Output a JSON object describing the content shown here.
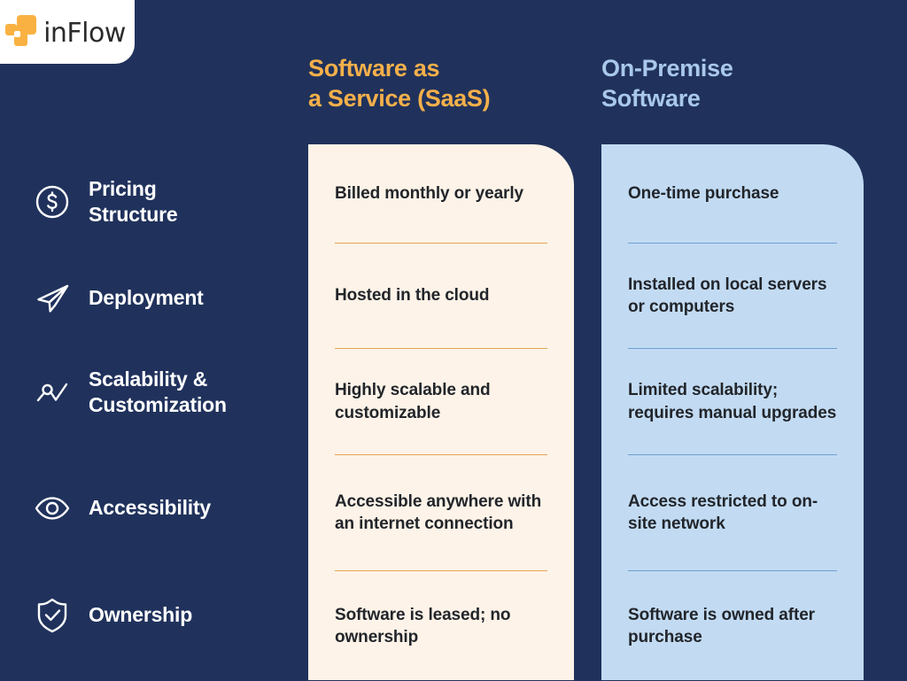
{
  "brand": {
    "logo_text": "inFlow",
    "logo_mark_name": "inflow-cube-logo",
    "logo_accent_color": "#f9b242"
  },
  "theme": {
    "background": "#20325c",
    "saas_accent": "#f5b04a",
    "saas_card_bg": "#fdf3e8",
    "saas_divider": "#e3a552",
    "onprem_accent": "#a9c8ea",
    "onprem_card_bg": "#c2dbf3",
    "onprem_divider": "#6f9fd0",
    "label_text": "#ffffff",
    "cell_text": "#22252a"
  },
  "columns": {
    "saas": {
      "heading": "Software as\na Service (SaaS)"
    },
    "onprem": {
      "heading": "On-Premise\nSoftware"
    }
  },
  "rows": [
    {
      "label": "Pricing\nStructure",
      "icon": "dollar-circle-icon",
      "saas": "Billed monthly or yearly",
      "onprem": "One-time purchase"
    },
    {
      "label": "Deployment",
      "icon": "paper-plane-icon",
      "saas": "Hosted in the cloud",
      "onprem": "Installed on local servers or computers"
    },
    {
      "label": "Scalability &\nCustomization",
      "icon": "growth-chart-icon",
      "saas": "Highly scalable and customizable",
      "onprem": "Limited scalability; requires manual upgrades"
    },
    {
      "label": "Accessibility",
      "icon": "eye-icon",
      "saas": "Accessible anywhere with an internet connection",
      "onprem": "Access restricted to on-site network"
    },
    {
      "label": "Ownership",
      "icon": "shield-check-icon",
      "saas": "Software is leased; no ownership",
      "onprem": "Software is owned after purchase"
    }
  ]
}
